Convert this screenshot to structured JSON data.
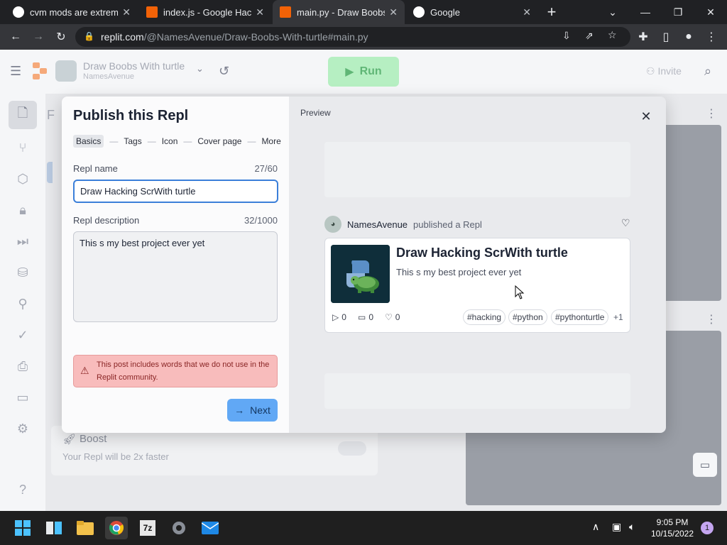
{
  "browser": {
    "tabs": [
      {
        "title": "cvm mods are extreme",
        "favicon_color": "#ffffff"
      },
      {
        "title": "index.js - Google Hacki",
        "favicon_color": "#f26207"
      },
      {
        "title": "main.py - Draw Boobs",
        "favicon_color": "#f26207",
        "active": true
      },
      {
        "title": "Google",
        "favicon_color": "#ffffff"
      }
    ],
    "url_host": "replit.com",
    "url_path": "/@NamesAvenue/Draw-Boobs-With-turtle#main.py"
  },
  "repl_header": {
    "repl_name": "Draw Boobs With turtle",
    "owner": "NamesAvenue",
    "run_label": "Run",
    "invite_label": "Invite"
  },
  "background": {
    "boost_title": "Boost",
    "boost_desc": "Your Repl will be 2x faster",
    "help_glyph": "?",
    "partial_letter": "F"
  },
  "publish_modal": {
    "title": "Publish this Repl",
    "steps": [
      "Basics",
      "Tags",
      "Icon",
      "Cover page",
      "More"
    ],
    "current_step": "Basics",
    "name_label": "Repl name",
    "name_count": "27/60",
    "name_value": "Draw Hacking ScrWith turtle",
    "desc_label": "Repl description",
    "desc_count": "32/1000",
    "desc_value": "This s my best project ever yet",
    "warning": "This post includes words that we do not use in the Replit community.",
    "next_label": "Next"
  },
  "preview": {
    "label": "Preview",
    "publisher": "NamesAvenue",
    "published_text": "published a Repl",
    "card_title": "Draw Hacking ScrWith turtle",
    "card_desc": "This s my best project ever yet",
    "runs": "0",
    "comments": "0",
    "likes": "0",
    "tags": [
      "#hacking",
      "#python",
      "#pythonturtle"
    ],
    "more_tags": "+1"
  },
  "taskbar": {
    "time": "9:05 PM",
    "date": "10/15/2022",
    "notification_count": "1"
  }
}
